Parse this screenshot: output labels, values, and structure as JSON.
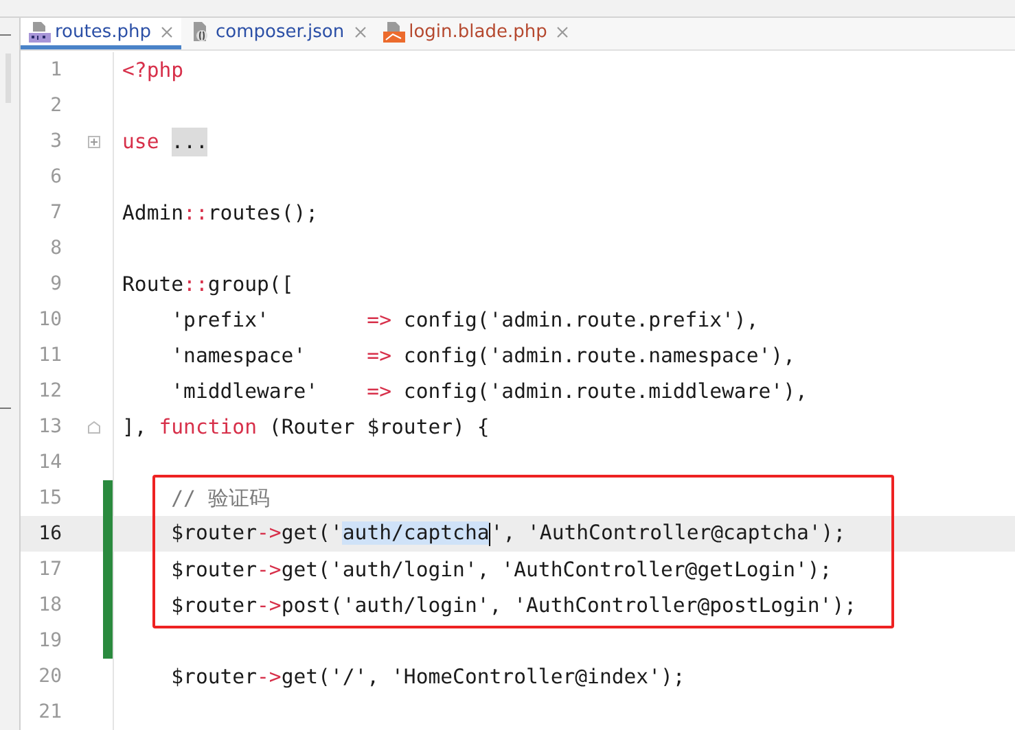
{
  "tabs": [
    {
      "label": "routes.php",
      "kind": "php",
      "selected": true,
      "color": "#2b4fa6"
    },
    {
      "label": "composer.json",
      "kind": "json",
      "selected": false,
      "color": "#2b4fa6"
    },
    {
      "label": "login.blade.php",
      "kind": "blade",
      "selected": false,
      "color": "#b5482e"
    }
  ],
  "lines": [
    {
      "number": "1",
      "tokens": [
        {
          "kind": "keyword",
          "text": "<?php"
        }
      ]
    },
    {
      "number": "2"
    },
    {
      "number": "3",
      "foldable": true,
      "collapsed": true,
      "tokens": [
        {
          "kind": "keyword",
          "text": "use"
        },
        {
          "kind": "folded",
          "text": "..."
        }
      ]
    },
    {
      "number": "6"
    },
    {
      "number": "7",
      "tokens": [
        {
          "kind": "text",
          "text": "Admin"
        },
        {
          "kind": "op",
          "text": "::"
        },
        {
          "kind": "text",
          "text": "routes();"
        }
      ]
    },
    {
      "number": "8"
    },
    {
      "number": "9",
      "tokens": [
        {
          "kind": "text",
          "text": "Route"
        },
        {
          "kind": "op",
          "text": "::"
        },
        {
          "kind": "text",
          "text": "group(["
        }
      ]
    },
    {
      "number": "10",
      "tokens": [
        {
          "kind": "text",
          "text": "    'prefix'        "
        },
        {
          "kind": "op",
          "text": "=>"
        },
        {
          "kind": "text",
          "text": " config('admin.route.prefix'),"
        }
      ]
    },
    {
      "number": "11",
      "tokens": [
        {
          "kind": "text",
          "text": "    'namespace'     "
        },
        {
          "kind": "op",
          "text": "=>"
        },
        {
          "kind": "text",
          "text": " config('admin.route.namespace'),"
        }
      ]
    },
    {
      "number": "12",
      "tokens": [
        {
          "kind": "text",
          "text": "    'middleware'    "
        },
        {
          "kind": "op",
          "text": "=>"
        },
        {
          "kind": "text",
          "text": " config('admin.route.middleware'),"
        }
      ]
    },
    {
      "number": "13",
      "foldable": true,
      "collapsed": false,
      "tokens": [
        {
          "kind": "text",
          "text": "], "
        },
        {
          "kind": "keyword",
          "text": "function"
        },
        {
          "kind": "text",
          "text": " (Router $router) {"
        }
      ]
    },
    {
      "number": "14"
    },
    {
      "number": "15",
      "changed": true,
      "boxed": true,
      "tokens": [
        {
          "kind": "comment",
          "text": "    // 验证码"
        }
      ]
    },
    {
      "number": "16",
      "changed": true,
      "boxed": true,
      "current": true,
      "tokens": [
        {
          "kind": "text",
          "text": "    $router"
        },
        {
          "kind": "op",
          "text": "->"
        },
        {
          "kind": "text",
          "text": "get('"
        },
        {
          "kind": "selection",
          "text": "auth/captcha"
        },
        {
          "kind": "text",
          "text": "', 'AuthController@captcha');"
        }
      ]
    },
    {
      "number": "17",
      "changed": true,
      "boxed": true,
      "tokens": [
        {
          "kind": "text",
          "text": "    $router"
        },
        {
          "kind": "op",
          "text": "->"
        },
        {
          "kind": "text",
          "text": "get('auth/login', 'AuthController@getLogin');"
        }
      ]
    },
    {
      "number": "18",
      "changed": true,
      "boxed": true,
      "tokens": [
        {
          "kind": "text",
          "text": "    $router"
        },
        {
          "kind": "op",
          "text": "->"
        },
        {
          "kind": "text",
          "text": "post('auth/login', 'AuthController@postLogin');"
        }
      ]
    },
    {
      "number": "19",
      "changed": true
    },
    {
      "number": "20",
      "tokens": [
        {
          "kind": "text",
          "text": "    $router"
        },
        {
          "kind": "op",
          "text": "->"
        },
        {
          "kind": "text",
          "text": "get('/', 'HomeController@index');"
        }
      ]
    },
    {
      "number": "21"
    }
  ]
}
